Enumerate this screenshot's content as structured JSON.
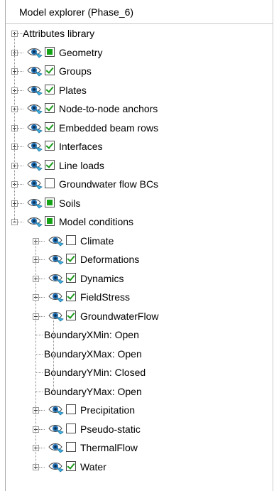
{
  "panel": {
    "title": "Model explorer (Phase_6)"
  },
  "tree": [
    {
      "label": "Attributes library",
      "level": 0,
      "expander": "plus",
      "eye": false,
      "check": "none"
    },
    {
      "label": "Geometry",
      "level": 0,
      "expander": "plus",
      "eye": true,
      "check": "filled"
    },
    {
      "label": "Groups",
      "level": 0,
      "expander": "plus",
      "eye": true,
      "check": "checked"
    },
    {
      "label": "Plates",
      "level": 0,
      "expander": "plus",
      "eye": true,
      "check": "checked"
    },
    {
      "label": "Node-to-node anchors",
      "level": 0,
      "expander": "plus",
      "eye": true,
      "check": "checked"
    },
    {
      "label": "Embedded beam rows",
      "level": 0,
      "expander": "plus",
      "eye": true,
      "check": "checked"
    },
    {
      "label": "Interfaces",
      "level": 0,
      "expander": "plus",
      "eye": true,
      "check": "checked"
    },
    {
      "label": "Line loads",
      "level": 0,
      "expander": "plus",
      "eye": true,
      "check": "checked"
    },
    {
      "label": "Groundwater flow BCs",
      "level": 0,
      "expander": "plus",
      "eye": true,
      "check": "unchecked"
    },
    {
      "label": "Soils",
      "level": 0,
      "expander": "plus",
      "eye": true,
      "check": "filled"
    },
    {
      "label": "Model conditions",
      "level": 0,
      "expander": "minus",
      "eye": true,
      "check": "filled"
    },
    {
      "label": "Climate",
      "level": 1,
      "expander": "plus",
      "eye": true,
      "check": "unchecked"
    },
    {
      "label": "Deformations",
      "level": 1,
      "expander": "plus",
      "eye": true,
      "check": "checked"
    },
    {
      "label": "Dynamics",
      "level": 1,
      "expander": "plus",
      "eye": true,
      "check": "checked"
    },
    {
      "label": "FieldStress",
      "level": 1,
      "expander": "plus",
      "eye": true,
      "check": "checked"
    },
    {
      "label": "GroundwaterFlow",
      "level": 1,
      "expander": "minus",
      "eye": true,
      "check": "checked"
    },
    {
      "label": "BoundaryXMin: Open",
      "level": 2,
      "expander": "none",
      "eye": false,
      "check": "none"
    },
    {
      "label": "BoundaryXMax: Open",
      "level": 2,
      "expander": "none",
      "eye": false,
      "check": "none"
    },
    {
      "label": "BoundaryYMin: Closed",
      "level": 2,
      "expander": "none",
      "eye": false,
      "check": "none"
    },
    {
      "label": "BoundaryYMax: Open",
      "level": 2,
      "expander": "none",
      "eye": false,
      "check": "none"
    },
    {
      "label": "Precipitation",
      "level": 1,
      "expander": "plus",
      "eye": true,
      "check": "unchecked"
    },
    {
      "label": "Pseudo-static",
      "level": 1,
      "expander": "plus",
      "eye": true,
      "check": "unchecked"
    },
    {
      "label": "ThermalFlow",
      "level": 1,
      "expander": "plus",
      "eye": true,
      "check": "unchecked"
    },
    {
      "label": "Water",
      "level": 1,
      "expander": "plus",
      "eye": true,
      "check": "checked"
    }
  ],
  "icons": {
    "eye": "eye-visibility-icon",
    "expander": "tree-expander-icon"
  },
  "colors": {
    "check": "#16a316",
    "eye_pupil": "#1f6fb5",
    "eye_accent": "#3fb4e6"
  }
}
